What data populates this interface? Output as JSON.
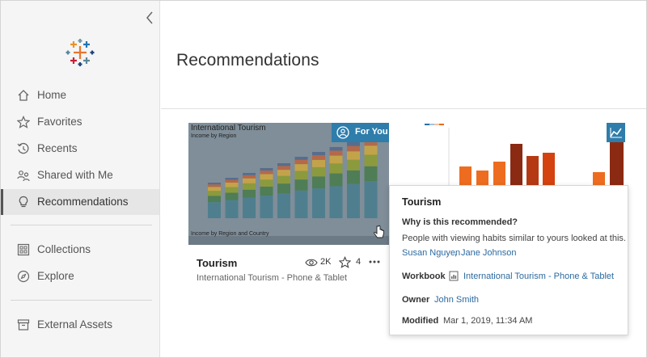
{
  "sidebar": {
    "items": [
      {
        "label": "Home",
        "icon": "home-icon"
      },
      {
        "label": "Favorites",
        "icon": "star-icon"
      },
      {
        "label": "Recents",
        "icon": "history-icon"
      },
      {
        "label": "Shared with Me",
        "icon": "shared-icon"
      },
      {
        "label": "Recommendations",
        "icon": "lightbulb-icon",
        "active": true
      },
      {
        "label": "Collections",
        "icon": "collections-icon"
      },
      {
        "label": "Explore",
        "icon": "compass-icon"
      },
      {
        "label": "External Assets",
        "icon": "archive-icon"
      }
    ]
  },
  "main": {
    "title": "Recommendations"
  },
  "card": {
    "thumbnail": {
      "title": "International Tourism",
      "subtitle": "Income by Region",
      "subtitle2": "Income by Region and Country"
    },
    "badge": "For You",
    "title": "Tourism",
    "subtitle": "International Tourism - Phone & Tablet",
    "views": "2K",
    "favorites": "4"
  },
  "popover": {
    "title": "Tourism",
    "why_heading": "Why is this recommended?",
    "description": "People with viewing habits similar to yours looked at this.",
    "users": [
      "Susan Nguyen",
      "Jane Johnson"
    ],
    "user_separator": ",",
    "workbook_label": "Workbook",
    "workbook_value": "International Tourism - Phone & Tablet",
    "owner_label": "Owner",
    "owner_value": "John Smith",
    "modified_label": "Modified",
    "modified_value": "Mar 1, 2019, 11:34 AM"
  },
  "colors": {
    "accent": "#2e7dab",
    "link": "#2c6aa0",
    "sidebar_bg": "#f5f5f5"
  }
}
